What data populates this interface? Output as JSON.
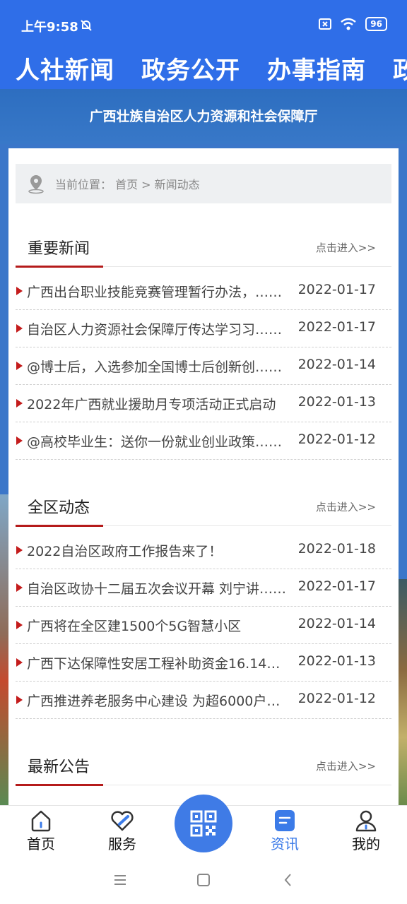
{
  "status_bar": {
    "time": "上午9:58",
    "battery": "96"
  },
  "top_nav": {
    "tabs": [
      "人社新闻",
      "政务公开",
      "办事指南",
      "政"
    ]
  },
  "banner": {
    "title": "广西壮族自治区人力资源和社会保障厅"
  },
  "breadcrumb": {
    "text": "当前位置： 首页 > 新闻动态"
  },
  "sections": [
    {
      "title": "重要新闻",
      "more": "点击进入>>",
      "items": [
        {
          "title": "广西出台职业技能竞赛管理暂行办法，……",
          "date": "2022-01-17"
        },
        {
          "title": "自治区人力资源社会保障厅传达学习习……",
          "date": "2022-01-17"
        },
        {
          "title": "@博士后，入选参加全国博士后创新创……",
          "date": "2022-01-14"
        },
        {
          "title": "2022年广西就业援助月专项活动正式启动",
          "date": "2022-01-13"
        },
        {
          "title": "@高校毕业生：送你一份就业创业政策……",
          "date": "2022-01-12"
        }
      ]
    },
    {
      "title": "全区动态",
      "more": "点击进入>>",
      "items": [
        {
          "title": "2022自治区政府工作报告来了！",
          "date": "2022-01-18"
        },
        {
          "title": "自治区政协十二届五次会议开幕 刘宁讲……",
          "date": "2022-01-17"
        },
        {
          "title": "广西将在全区建1500个5G智慧小区",
          "date": "2022-01-14"
        },
        {
          "title": "广西下达保障性安居工程补助资金16.14……",
          "date": "2022-01-13"
        },
        {
          "title": "广西推进养老服务中心建设 为超6000户……",
          "date": "2022-01-12"
        }
      ]
    },
    {
      "title": "最新公告",
      "more": "点击进入>>",
      "items": []
    }
  ],
  "bottom_nav": {
    "items": [
      {
        "label": "首页",
        "icon": "home-icon"
      },
      {
        "label": "服务",
        "icon": "heart-service-icon"
      },
      {
        "label": "资讯",
        "icon": "news-icon",
        "active": true
      },
      {
        "label": "我的",
        "icon": "user-icon"
      }
    ],
    "scan_icon": "qr-code-icon"
  },
  "colors": {
    "primary": "#2f6ee8",
    "accent_red": "#b51b1b",
    "active_tab": "#3b7be8"
  }
}
